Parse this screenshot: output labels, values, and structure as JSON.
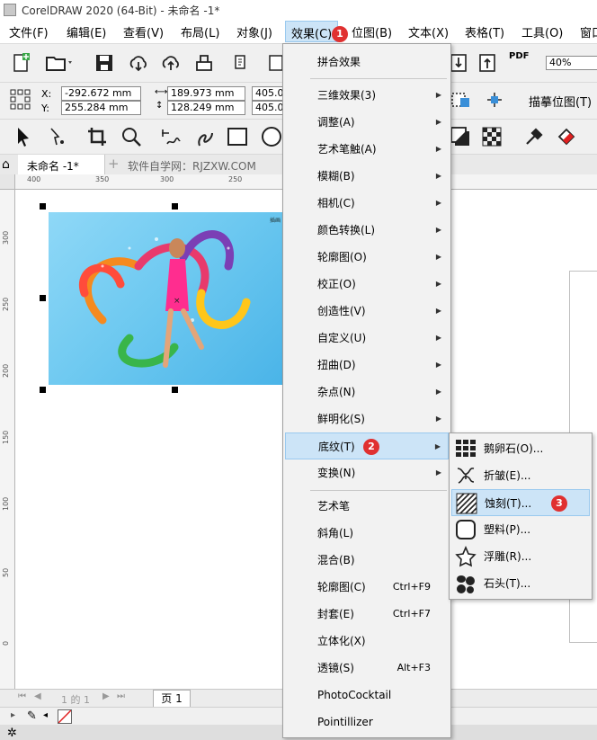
{
  "window": {
    "title": "CorelDRAW 2020 (64-Bit) - 未命名 -1*"
  },
  "menubar": {
    "items": [
      "文件(F)",
      "编辑(E)",
      "查看(V)",
      "布局(L)",
      "对象(J)",
      "效果(C)",
      "位图(B)",
      "文本(X)",
      "表格(T)",
      "工具(O)",
      "窗口"
    ],
    "active_index": 5
  },
  "toolbar": {
    "zoom_value": "40%",
    "pdf_label": "PDF"
  },
  "property_bar": {
    "x_label": "X:",
    "y_label": "Y:",
    "x_value": "-292.672 mm",
    "y_value": "255.284 mm",
    "width_value": "189.973 mm",
    "height_value": "128.249 mm",
    "scale_w": "405.0",
    "scale_h": "405.0",
    "trace_bitmap": "描摹位图(T)"
  },
  "tabs": {
    "doc_tab": "未命名 -1*",
    "add_tab": "+",
    "watermark": "软件自学网：RJZXW.COM"
  },
  "rulers": {
    "horizontal": [
      "400",
      "350",
      "300",
      "250"
    ],
    "vertical": [
      "300",
      "250",
      "200",
      "150",
      "100",
      "50",
      "0"
    ]
  },
  "artwork": {
    "caption": "插画"
  },
  "pager": {
    "page_info": "1 的 1",
    "page_tab": "页 1"
  },
  "effects_menu": {
    "items": [
      {
        "label": "拼合效果",
        "shortcut": "",
        "submenu": false
      },
      {
        "label": "三维效果(3)",
        "shortcut": "",
        "submenu": true
      },
      {
        "label": "调整(A)",
        "shortcut": "",
        "submenu": true
      },
      {
        "label": "艺术笔触(A)",
        "shortcut": "",
        "submenu": true
      },
      {
        "label": "模糊(B)",
        "shortcut": "",
        "submenu": true
      },
      {
        "label": "相机(C)",
        "shortcut": "",
        "submenu": true
      },
      {
        "label": "颜色转换(L)",
        "shortcut": "",
        "submenu": true
      },
      {
        "label": "轮廓图(O)",
        "shortcut": "",
        "submenu": true
      },
      {
        "label": "校正(O)",
        "shortcut": "",
        "submenu": true
      },
      {
        "label": "创造性(V)",
        "shortcut": "",
        "submenu": true
      },
      {
        "label": "自定义(U)",
        "shortcut": "",
        "submenu": true
      },
      {
        "label": "扭曲(D)",
        "shortcut": "",
        "submenu": true
      },
      {
        "label": "杂点(N)",
        "shortcut": "",
        "submenu": true
      },
      {
        "label": "鲜明化(S)",
        "shortcut": "",
        "submenu": true
      },
      {
        "label": "底纹(T)",
        "shortcut": "",
        "submenu": true
      },
      {
        "label": "变换(N)",
        "shortcut": "",
        "submenu": true
      },
      {
        "label": "艺术笔",
        "shortcut": "",
        "submenu": false
      },
      {
        "label": "斜角(L)",
        "shortcut": "",
        "submenu": false
      },
      {
        "label": "混合(B)",
        "shortcut": "",
        "submenu": false
      },
      {
        "label": "轮廓图(C)",
        "shortcut": "Ctrl+F9",
        "submenu": false
      },
      {
        "label": "封套(E)",
        "shortcut": "Ctrl+F7",
        "submenu": false
      },
      {
        "label": "立体化(X)",
        "shortcut": "",
        "submenu": false
      },
      {
        "label": "透镜(S)",
        "shortcut": "Alt+F3",
        "submenu": false
      },
      {
        "label": "PhotoCocktail",
        "shortcut": "",
        "submenu": false
      },
      {
        "label": "Pointillizer",
        "shortcut": "",
        "submenu": false
      }
    ],
    "highlight_index": 14
  },
  "texture_submenu": {
    "items": [
      {
        "label": "鹅卵石(O)...",
        "icon": "cobblestone-icon"
      },
      {
        "label": "折皱(E)...",
        "icon": "elephant-skin-icon"
      },
      {
        "label": "蚀刻(T)...",
        "icon": "etching-icon"
      },
      {
        "label": "塑料(P)...",
        "icon": "plastic-icon"
      },
      {
        "label": "浮雕(R)...",
        "icon": "relief-star-icon"
      },
      {
        "label": "石头(T)...",
        "icon": "stone-icon"
      }
    ],
    "highlight_index": 2
  },
  "annotations": [
    "1",
    "2",
    "3"
  ],
  "colors": {
    "highlight": "#cce4f7",
    "highlight_border": "#99c9ef",
    "badge": "#e03030",
    "sky": "#6cc8f0"
  }
}
